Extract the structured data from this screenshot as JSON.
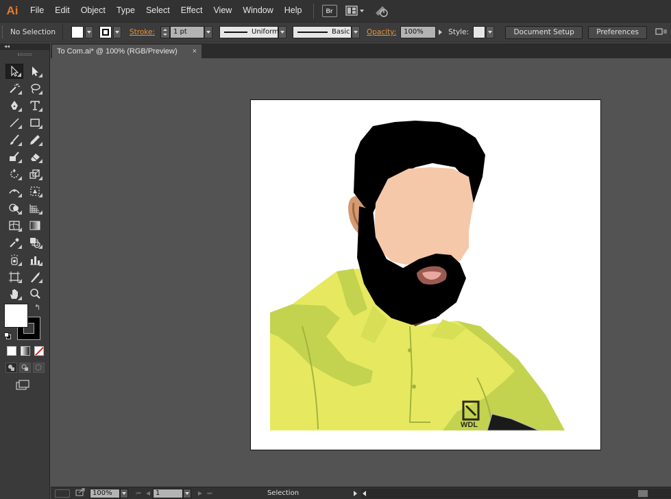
{
  "app": {
    "logo": "Ai"
  },
  "menu": [
    "File",
    "Edit",
    "Object",
    "Type",
    "Select",
    "Effect",
    "View",
    "Window",
    "Help"
  ],
  "menu_icons": [
    "bridge-icon",
    "arrange-documents-icon",
    "gpu-performance-icon"
  ],
  "bridge_label": "Br",
  "control_bar": {
    "selection_status": "No Selection",
    "fill_color": "#ffffff",
    "stroke_label": "Stroke:",
    "stroke_weight": "1 pt",
    "variable_width_profile": "Uniform",
    "brush_definition": "Basic",
    "opacity_label": "Opacity:",
    "opacity_value": "100%",
    "style_label": "Style:",
    "document_setup": "Document Setup",
    "preferences": "Preferences"
  },
  "document": {
    "tab_title": "To Com.ai* @ 100% (RGB/Preview)",
    "close_glyph": "×"
  },
  "status_bar": {
    "zoom": "100%",
    "artboard_number": "1",
    "current_tool": "Selection"
  },
  "tools_panel": {
    "collapse_glyph": "◂◂",
    "fill_color": "#ffffff",
    "stroke_color": "#000000"
  },
  "colors": {
    "shirt": "#e6e960",
    "shirt_shadow": "#c3d34f",
    "skin": "#f4c8a8",
    "hair": "#000000",
    "accent": "#e87a2a"
  }
}
